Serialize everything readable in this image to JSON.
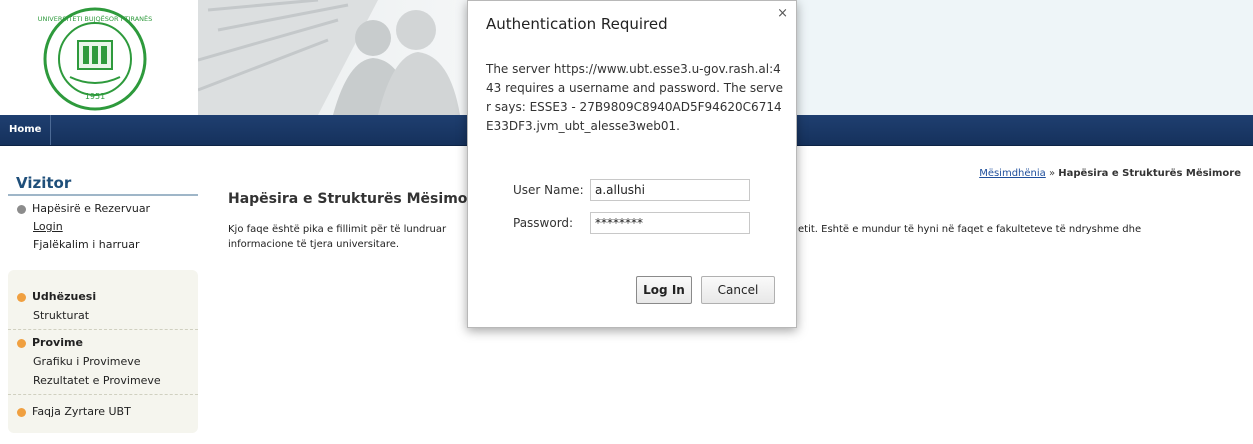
{
  "colors": {
    "nav": "#1f3f70",
    "sidebar_title": "#1f4f7a",
    "bullet_orange": "#f0a040",
    "seal_green": "#2e9a3c"
  },
  "logo": {
    "text_top": "UNIVERSITETI BUJQËSOR I TIRANËS",
    "year": "1951"
  },
  "nav": {
    "home": "Home"
  },
  "sidebar": {
    "title": "Vizitor",
    "reserved": {
      "label": "Hapësirë e Rezervuar",
      "items": [
        "Login",
        "Fjalëkalim i harruar"
      ]
    },
    "sections": [
      {
        "title": "Udhëzuesi",
        "items": [
          "Strukturat"
        ]
      },
      {
        "title": "Provime",
        "items": [
          "Grafiku i Provimeve",
          "Rezultatet e Provimeve"
        ]
      }
    ],
    "extra_link": "Faqja Zyrtare UBT"
  },
  "breadcrumb": {
    "link": "Mësimdhënia",
    "separator": "»",
    "current": "Hapësira e Strukturës Mësimore"
  },
  "page": {
    "title": "Hapësira e Strukturës Mësimore",
    "intro_left": "Kjo faqe është pika e fillimit për të lundruar",
    "intro_right": "etit. Eshtë e mundur të hyni në faqet e fakulteteve të ndryshme dhe",
    "intro_line2": "informacione të tjera universitare."
  },
  "dialog": {
    "title": "Authentication Required",
    "close": "×",
    "message": "The server https://www.ubt.esse3.u-gov.rash.al:443 requires a username and password. The server says: ESSE3 - 27B9809C8940AD5F94620C6714E33DF3.jvm_ubt_alesse3web01.",
    "username_label": "User Name:",
    "username_value": "a.allushi",
    "password_label": "Password:",
    "password_value": "********",
    "login_button": "Log In",
    "cancel_button": "Cancel"
  }
}
